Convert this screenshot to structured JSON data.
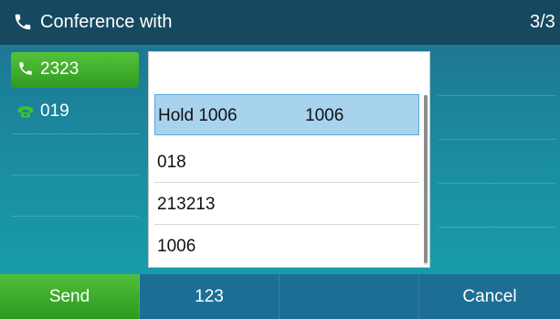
{
  "titlebar": {
    "title": "Conference with",
    "page_indicator": "3/3",
    "icon": "phone-icon"
  },
  "lines": [
    {
      "label": "2323",
      "icon": "phone-handset-icon",
      "active": true
    },
    {
      "label": "019",
      "icon": "held-call-icon",
      "active": false
    }
  ],
  "popup": {
    "items": [
      {
        "label": "Hold 1006",
        "number": "1006",
        "selected": true
      },
      {
        "label": "018",
        "number": "",
        "selected": false
      },
      {
        "label": "213213",
        "number": "",
        "selected": false
      },
      {
        "label": "1006",
        "number": "",
        "selected": false
      }
    ]
  },
  "softkeys": [
    {
      "label": "Send"
    },
    {
      "label": "123"
    },
    {
      "label": ""
    },
    {
      "label": "Cancel"
    }
  ],
  "colors": {
    "titlebar_bg": "#16495f",
    "accent_green": "#3aa82a",
    "selection_blue": "#a8d3ef"
  }
}
